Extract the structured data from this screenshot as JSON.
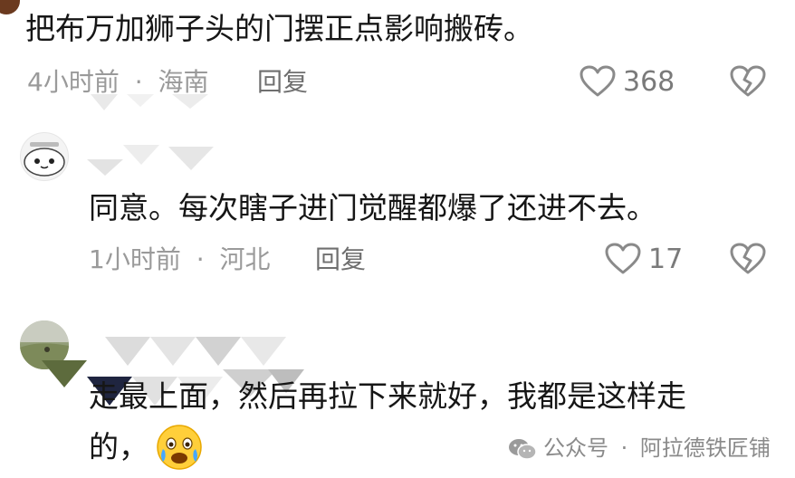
{
  "comments": [
    {
      "text": "把布万加狮子头的门摆正点影响搬砖。",
      "time": "4小时前",
      "separator": "·",
      "location": "海南",
      "reply_label": "回复",
      "likes": "368"
    },
    {
      "text": "同意。每次瞎子进门觉醒都爆了还进不去。",
      "time": "1小时前",
      "separator": "·",
      "location": "河北",
      "reply_label": "回复",
      "likes": "17"
    },
    {
      "text_line1": "走最上面，然后再拉下来就好，我都是这样走",
      "text_line2": "的，"
    }
  ],
  "watermark": {
    "platform": "公众号",
    "separator": "·",
    "account": "阿拉德铁匠铺"
  },
  "icons": {
    "like": "heart-outline-icon",
    "dislike": "broken-heart-icon",
    "emoji": "crying-laughing-emoji-icon",
    "wechat": "wechat-logo-icon"
  },
  "colors": {
    "text": "#161616",
    "meta": "#9a9a9a",
    "icon": "#8a8a8a"
  }
}
